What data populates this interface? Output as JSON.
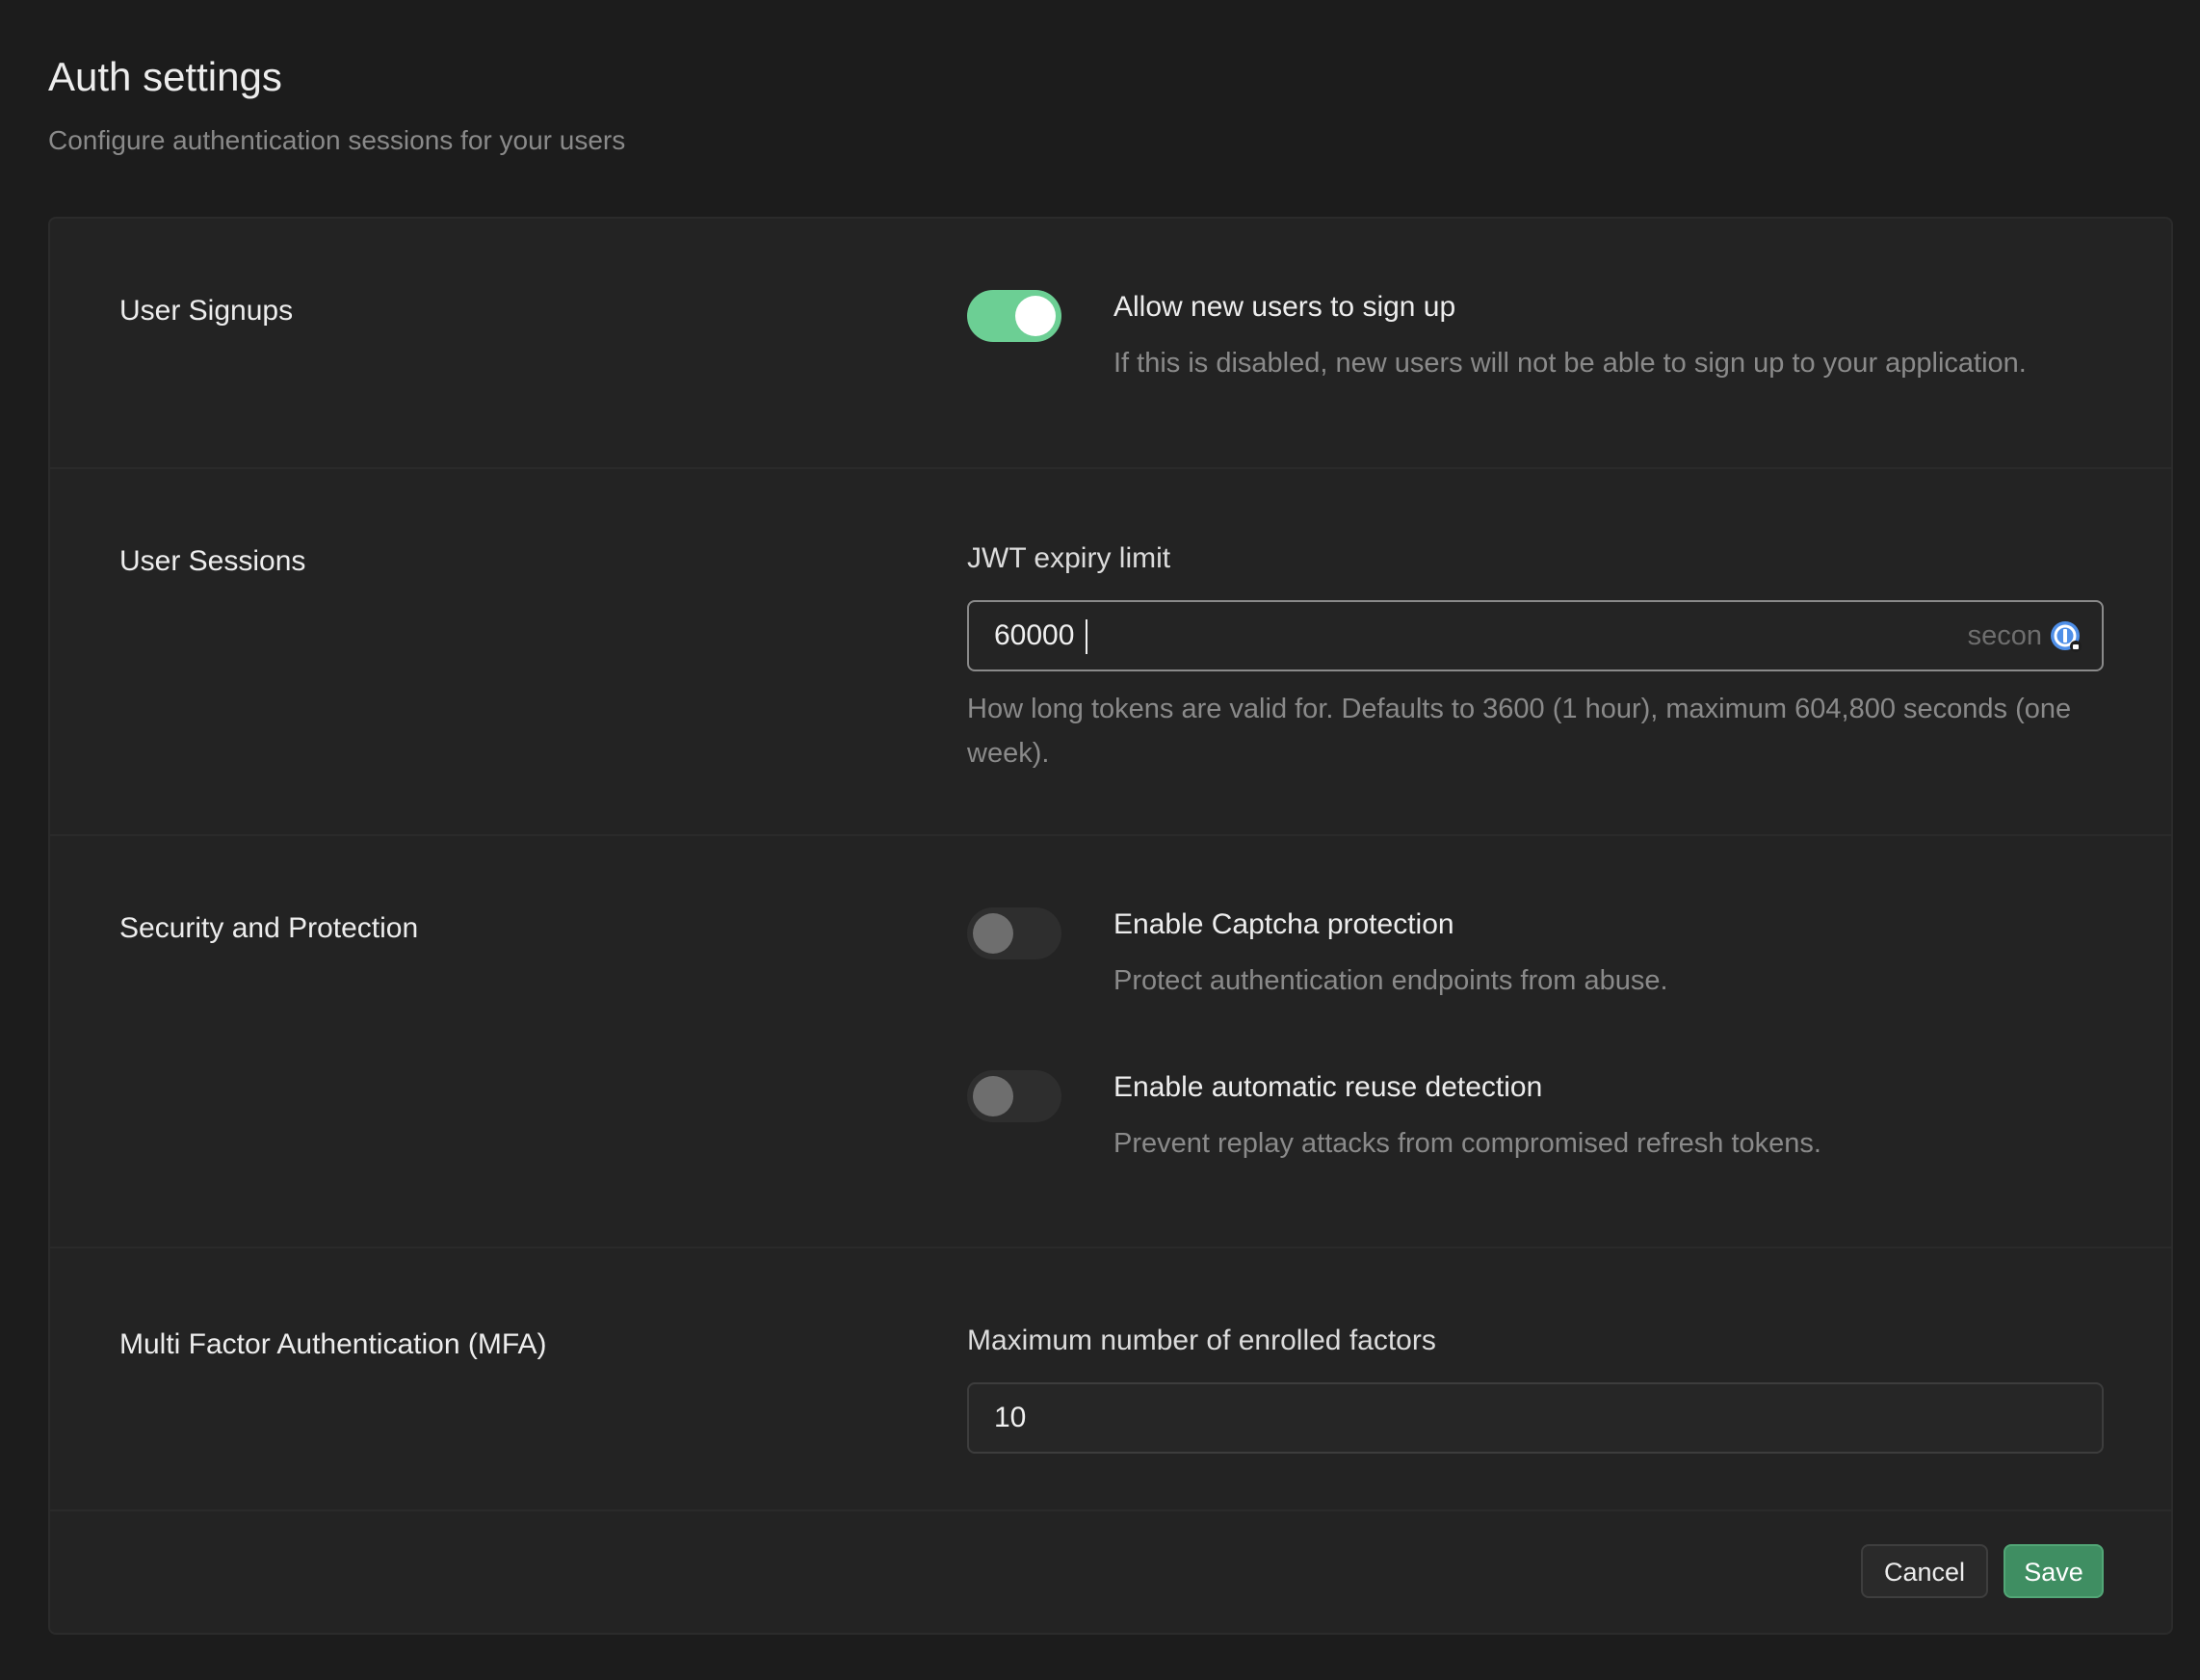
{
  "header": {
    "title": "Auth settings",
    "subtitle": "Configure authentication sessions for your users"
  },
  "sections": {
    "signups": {
      "label": "User Signups",
      "option_title": "Allow new users to sign up",
      "option_desc": "If this is disabled, new users will not be able to sign up to your application.",
      "enabled": true
    },
    "sessions": {
      "label": "User Sessions",
      "field_label": "JWT expiry limit",
      "value": "60000",
      "suffix": "secon",
      "help": "How long tokens are valid for. Defaults to 3600 (1 hour), maximum 604,800 seconds (one week)."
    },
    "security": {
      "label": "Security and Protection",
      "captcha_title": "Enable Captcha protection",
      "captcha_desc": "Protect authentication endpoints from abuse.",
      "captcha_enabled": false,
      "reuse_title": "Enable automatic reuse detection",
      "reuse_desc": "Prevent replay attacks from compromised refresh tokens.",
      "reuse_enabled": false
    },
    "mfa": {
      "label": "Multi Factor Authentication (MFA)",
      "field_label": "Maximum number of enrolled factors",
      "value": "10"
    }
  },
  "footer": {
    "cancel_label": "Cancel",
    "save_label": "Save"
  },
  "colors": {
    "toggle_on": "#6ccf94",
    "save_button": "#3f8e62",
    "password_manager_icon": "#4f8fe8"
  },
  "icons": {
    "password_manager": "password-manager-icon"
  }
}
